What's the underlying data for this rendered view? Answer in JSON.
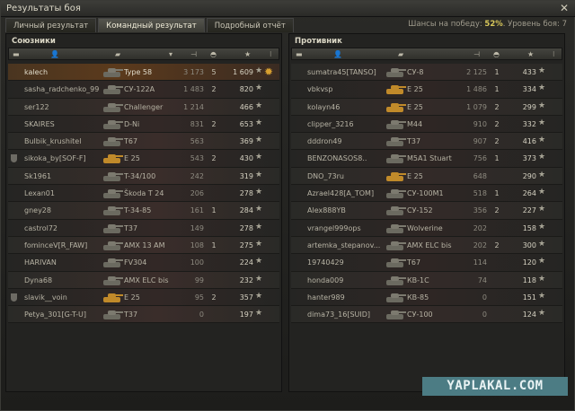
{
  "window": {
    "title": "Результаты боя",
    "close_label": "✕"
  },
  "tabs": [
    {
      "label": "Личный результат",
      "active": false
    },
    {
      "label": "Командный результат",
      "active": true
    },
    {
      "label": "Подробный отчёт",
      "active": false
    }
  ],
  "win_chance": {
    "prefix": "Шансы на победу: ",
    "value": "52%",
    "level_text": ". Уровень боя: 7"
  },
  "allies": {
    "title": "Союзники",
    "rows": [
      {
        "player": "kalech",
        "tank": "Type 58",
        "damage": "3 173",
        "frags": "5",
        "xp": "1 609",
        "self": true,
        "medal": true,
        "clan_icon": false,
        "tank_color": "dark"
      },
      {
        "player": "sasha_radchenko_99",
        "tank": "СУ-122А",
        "damage": "1 483",
        "frags": "2",
        "xp": "820",
        "self": false,
        "medal": false,
        "clan_icon": false,
        "tank_color": "dark"
      },
      {
        "player": "ser122",
        "tank": "Challenger",
        "damage": "1 214",
        "frags": "",
        "xp": "466",
        "self": false,
        "medal": false,
        "clan_icon": false,
        "tank_color": "dark"
      },
      {
        "player": "SKAIRES",
        "tank": "D-Ni",
        "damage": "831",
        "frags": "2",
        "xp": "653",
        "self": false,
        "medal": false,
        "clan_icon": false,
        "tank_color": "dark"
      },
      {
        "player": "Bulbik_krushitel",
        "tank": "T67",
        "damage": "563",
        "frags": "",
        "xp": "369",
        "self": false,
        "medal": false,
        "clan_icon": false,
        "tank_color": "dark"
      },
      {
        "player": "sikoka_by[SOF-F]",
        "tank": "E 25",
        "damage": "543",
        "frags": "2",
        "xp": "430",
        "self": false,
        "medal": false,
        "clan_icon": true,
        "tank_color": "gold"
      },
      {
        "player": "Sk1961",
        "tank": "T-34/100",
        "damage": "242",
        "frags": "",
        "xp": "319",
        "self": false,
        "medal": false,
        "clan_icon": false,
        "tank_color": "dark"
      },
      {
        "player": "Lexan01",
        "tank": "Škoda T 24",
        "damage": "206",
        "frags": "",
        "xp": "278",
        "self": false,
        "medal": false,
        "clan_icon": false,
        "tank_color": "dark"
      },
      {
        "player": "gney28",
        "tank": "T-34-85",
        "damage": "161",
        "frags": "1",
        "xp": "284",
        "self": false,
        "medal": false,
        "clan_icon": false,
        "tank_color": "dark"
      },
      {
        "player": "castrol72",
        "tank": "T37",
        "damage": "149",
        "frags": "",
        "xp": "278",
        "self": false,
        "medal": false,
        "clan_icon": false,
        "tank_color": "dark"
      },
      {
        "player": "fominceV[R_FAW]",
        "tank": "AMX 13 AM",
        "damage": "108",
        "frags": "1",
        "xp": "275",
        "self": false,
        "medal": false,
        "clan_icon": false,
        "tank_color": "dark"
      },
      {
        "player": "HARIVAN",
        "tank": "FV304",
        "damage": "100",
        "frags": "",
        "xp": "224",
        "self": false,
        "medal": false,
        "clan_icon": false,
        "tank_color": "dark"
      },
      {
        "player": "Dyna68",
        "tank": "AMX ELC bis",
        "damage": "99",
        "frags": "",
        "xp": "232",
        "self": false,
        "medal": false,
        "clan_icon": false,
        "tank_color": "dark"
      },
      {
        "player": "slavik__voin",
        "tank": "E 25",
        "damage": "95",
        "frags": "2",
        "xp": "357",
        "self": false,
        "medal": false,
        "clan_icon": true,
        "tank_color": "gold"
      },
      {
        "player": "Petya_301[G-T-U]",
        "tank": "T37",
        "damage": "0",
        "frags": "",
        "xp": "197",
        "self": false,
        "medal": false,
        "clan_icon": false,
        "tank_color": "dark"
      }
    ]
  },
  "enemies": {
    "title": "Противник",
    "rows": [
      {
        "player": "sumatra45[TANSO]",
        "tank": "СУ-8",
        "damage": "2 125",
        "frags": "1",
        "xp": "433",
        "tank_color": "dark"
      },
      {
        "player": "vbkvsp",
        "tank": "E 25",
        "damage": "1 486",
        "frags": "1",
        "xp": "334",
        "tank_color": "gold"
      },
      {
        "player": "kolayn46",
        "tank": "E 25",
        "damage": "1 079",
        "frags": "2",
        "xp": "299",
        "tank_color": "gold"
      },
      {
        "player": "clipper_3216",
        "tank": "M44",
        "damage": "910",
        "frags": "2",
        "xp": "332",
        "tank_color": "dark"
      },
      {
        "player": "dddron49",
        "tank": "T37",
        "damage": "907",
        "frags": "2",
        "xp": "416",
        "tank_color": "dark"
      },
      {
        "player": "BENZONASOS8..",
        "tank": "M5A1 Stuart",
        "damage": "756",
        "frags": "1",
        "xp": "373",
        "tank_color": "dark"
      },
      {
        "player": "DNO_73ru",
        "tank": "E 25",
        "damage": "648",
        "frags": "",
        "xp": "290",
        "tank_color": "gold"
      },
      {
        "player": "Azrael428[A_TOM]",
        "tank": "СУ-100М1",
        "damage": "518",
        "frags": "1",
        "xp": "264",
        "tank_color": "dark"
      },
      {
        "player": "Alex888YB",
        "tank": "СУ-152",
        "damage": "356",
        "frags": "2",
        "xp": "227",
        "tank_color": "dark"
      },
      {
        "player": "vrangel999ops",
        "tank": "Wolverine",
        "damage": "202",
        "frags": "",
        "xp": "158",
        "tank_color": "dark"
      },
      {
        "player": "artemka_stepanov...",
        "tank": "AMX ELC bis",
        "damage": "202",
        "frags": "2",
        "xp": "300",
        "tank_color": "dark"
      },
      {
        "player": "19740429",
        "tank": "T67",
        "damage": "114",
        "frags": "",
        "xp": "120",
        "tank_color": "dark"
      },
      {
        "player": "honda009",
        "tank": "КВ-1С",
        "damage": "74",
        "frags": "",
        "xp": "118",
        "tank_color": "dark"
      },
      {
        "player": "hanter989",
        "tank": "КВ-85",
        "damage": "0",
        "frags": "",
        "xp": "151",
        "tank_color": "dark"
      },
      {
        "player": "dima73_16[SUID]",
        "tank": "СУ-100",
        "damage": "0",
        "frags": "",
        "xp": "124",
        "tank_color": "dark"
      }
    ]
  },
  "watermark": "YAPLAKAL.COM"
}
